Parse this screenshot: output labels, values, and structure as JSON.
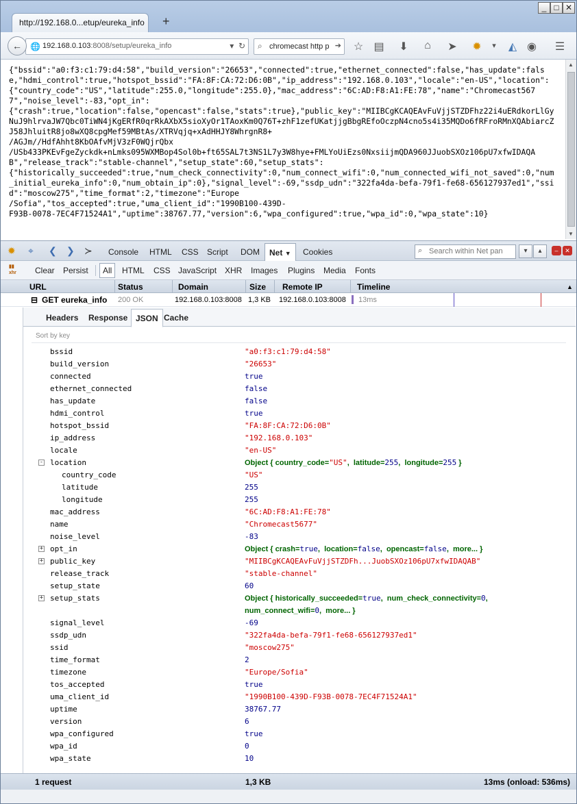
{
  "browser": {
    "tab_title": "http://192.168.0...etup/eureka_info",
    "new_tab": "+",
    "win_min": "_",
    "win_max": "□",
    "win_close": "✕",
    "url_host": "192.168.0.103",
    "url_rest": ":8008/setup/eureka_info",
    "search_text": "chromecast http p"
  },
  "raw_json": "{\"bssid\":\"a0:f3:c1:79:d4:58\",\"build_version\":\"26653\",\"connected\":true,\"ethernet_connected\":false,\"has_update\":false,\"hdmi_control\":true,\"hotspot_bssid\":\"FA:8F:CA:72:D6:0B\",\"ip_address\":\"192.168.0.103\",\"locale\":\"en-US\",\"location\":\n{\"country_code\":\"US\",\"latitude\":255.0,\"longitude\":255.0},\"mac_address\":\"6C:AD:F8:A1:FE:78\",\"name\":\"Chromecast5677\",\"noise_level\":-83,\"opt_in\":\n{\"crash\":true,\"location\":false,\"opencast\":false,\"stats\":true},\"public_key\":\"MIIBCgKCAQEAvFuVjjSTZDFhz22i4uERdkorLlGyNuJ9hlrvaJW7Qbc0TiWN4jKgERfR0qrRkAXbX5sioXyOr1TAoxKm0Q76T+zhF1zefUKatjjgBbgREfoOczpN4cno5s4i35MQDo6fRFroRMnXQAbiarcZJ58JhluitR8jo8wXQ8cpgMef59MBtAs/XTRVqjq+xAdHHJY8WhrgnR8+\n/AGJm//HdfAhht8KbOAfvMjV3zF0WQjrQbx\n/USb433PKEvFgeZyckdk+nLmks095WXMBop4Sol0b+ft65SAL7t3NS1L7y3W8hye+FMLYoUiEzs0NxsiijmQDA960JJuobSXOz106pU7xfwIDAQAB\",\"release_track\":\"stable-channel\",\"setup_state\":60,\"setup_stats\":\n{\"historically_succeeded\":true,\"num_check_connectivity\":0,\"num_connect_wifi\":0,\"num_connected_wifi_not_saved\":0,\"num_initial_eureka_info\":0,\"num_obtain_ip\":0},\"signal_level\":-69,\"ssdp_udn\":\"322fa4da-befa-79f1-fe68-656127937ed1\",\"ssid\":\"moscow275\",\"time_format\":2,\"timezone\":\"Europe\n/Sofia\",\"tos_accepted\":true,\"uma_client_id\":\"1990B100-439D-\nF93B-0078-7EC4F71524A1\",\"uptime\":38767.77,\"version\":6,\"wpa_configured\":true,\"wpa_id\":0,\"wpa_state\":10}",
  "firebug": {
    "panels": [
      "Console",
      "HTML",
      "CSS",
      "Script",
      "DOM",
      "Net",
      "Cookies"
    ],
    "active_panel": "Net",
    "search_placeholder": "Search within Net pan",
    "subbar": {
      "clear": "Clear",
      "persist": "Persist",
      "filters": [
        "All",
        "HTML",
        "CSS",
        "JavaScript",
        "XHR",
        "Images",
        "Plugins",
        "Media",
        "Fonts"
      ],
      "xhr_label": "xhr"
    },
    "columns": [
      "URL",
      "Status",
      "Domain",
      "Size",
      "Remote IP",
      "Timeline"
    ],
    "request": {
      "expand": "⊟",
      "url": "GET eureka_info",
      "status": "200 OK",
      "domain": "192.168.0.103:8008",
      "size": "1,3 KB",
      "remote_ip": "192.168.0.103:8008",
      "timeline": "13ms"
    },
    "detail_tabs": [
      "Headers",
      "Response",
      "JSON",
      "Cache"
    ],
    "active_detail_tab": "JSON",
    "sort_label": "Sort by key",
    "status": {
      "requests": "1 request",
      "size": "1,3 KB",
      "time": "13ms (onload: 536ms)"
    }
  },
  "props": [
    {
      "key": "bssid",
      "value": "\"a0:f3:c1:79:d4:58\"",
      "type": "str"
    },
    {
      "key": "build_version",
      "value": "\"26653\"",
      "type": "str"
    },
    {
      "key": "connected",
      "value": "true",
      "type": "num"
    },
    {
      "key": "ethernet_connected",
      "value": "false",
      "type": "num"
    },
    {
      "key": "has_update",
      "value": "false",
      "type": "num"
    },
    {
      "key": "hdmi_control",
      "value": "true",
      "type": "num"
    },
    {
      "key": "hotspot_bssid",
      "value": "\"FA:8F:CA:72:D6:0B\"",
      "type": "str"
    },
    {
      "key": "ip_address",
      "value": "\"192.168.0.103\"",
      "type": "str"
    },
    {
      "key": "locale",
      "value": "\"en-US\"",
      "type": "str"
    },
    {
      "key": "location",
      "type": "obj",
      "toggle": "-",
      "summary": [
        [
          "Object { ",
          "plain"
        ],
        [
          "country_code=",
          "key"
        ],
        [
          "\"US\"",
          "str"
        ],
        [
          ",  latitude=",
          "key"
        ],
        [
          "255",
          "num"
        ],
        [
          ",  longitude=",
          "key"
        ],
        [
          "255",
          "num"
        ],
        [
          " }",
          "plain"
        ]
      ]
    },
    {
      "key": "country_code",
      "value": "\"US\"",
      "type": "str",
      "child": true
    },
    {
      "key": "latitude",
      "value": "255",
      "type": "num",
      "child": true
    },
    {
      "key": "longitude",
      "value": "255",
      "type": "num",
      "child": true
    },
    {
      "key": "mac_address",
      "value": "\"6C:AD:F8:A1:FE:78\"",
      "type": "str"
    },
    {
      "key": "name",
      "value": "\"Chromecast5677\"",
      "type": "str"
    },
    {
      "key": "noise_level",
      "value": "-83",
      "type": "num"
    },
    {
      "key": "opt_in",
      "type": "obj",
      "toggle": "+",
      "summary": [
        [
          "Object { ",
          "plain"
        ],
        [
          "crash=",
          "key"
        ],
        [
          "true",
          "num"
        ],
        [
          ",  location=",
          "key"
        ],
        [
          "false",
          "num"
        ],
        [
          ",  opencast=",
          "key"
        ],
        [
          "false",
          "num"
        ],
        [
          ",  more... }",
          "plain"
        ]
      ]
    },
    {
      "key": "public_key",
      "value": "\"MIIBCgKCAQEAvFuVjjSTZDFh...JuobSXOz106pU7xfwIDAQAB\"",
      "type": "str",
      "toggle": "+"
    },
    {
      "key": "release_track",
      "value": "\"stable-channel\"",
      "type": "str"
    },
    {
      "key": "setup_state",
      "value": "60",
      "type": "num"
    },
    {
      "key": "setup_stats",
      "type": "obj",
      "toggle": "+",
      "tall": true,
      "summary": [
        [
          "Object { ",
          "plain"
        ],
        [
          "historically_succeeded=",
          "key"
        ],
        [
          "true",
          "num"
        ],
        [
          ",  num_check_connectivity=",
          "key"
        ],
        [
          "0",
          "num"
        ],
        [
          ",\n",
          "plain"
        ],
        [
          "num_connect_wifi=",
          "key"
        ],
        [
          "0",
          "num"
        ],
        [
          ",  more... }",
          "plain"
        ]
      ]
    },
    {
      "key": "signal_level",
      "value": "-69",
      "type": "num"
    },
    {
      "key": "ssdp_udn",
      "value": "\"322fa4da-befa-79f1-fe68-656127937ed1\"",
      "type": "str"
    },
    {
      "key": "ssid",
      "value": "\"moscow275\"",
      "type": "str"
    },
    {
      "key": "time_format",
      "value": "2",
      "type": "num"
    },
    {
      "key": "timezone",
      "value": "\"Europe/Sofia\"",
      "type": "str"
    },
    {
      "key": "tos_accepted",
      "value": "true",
      "type": "num"
    },
    {
      "key": "uma_client_id",
      "value": "\"1990B100-439D-F93B-0078-7EC4F71524A1\"",
      "type": "str"
    },
    {
      "key": "uptime",
      "value": "38767.77",
      "type": "num"
    },
    {
      "key": "version",
      "value": "6",
      "type": "num"
    },
    {
      "key": "wpa_configured",
      "value": "true",
      "type": "num"
    },
    {
      "key": "wpa_id",
      "value": "0",
      "type": "num"
    },
    {
      "key": "wpa_state",
      "value": "10",
      "type": "num"
    }
  ]
}
